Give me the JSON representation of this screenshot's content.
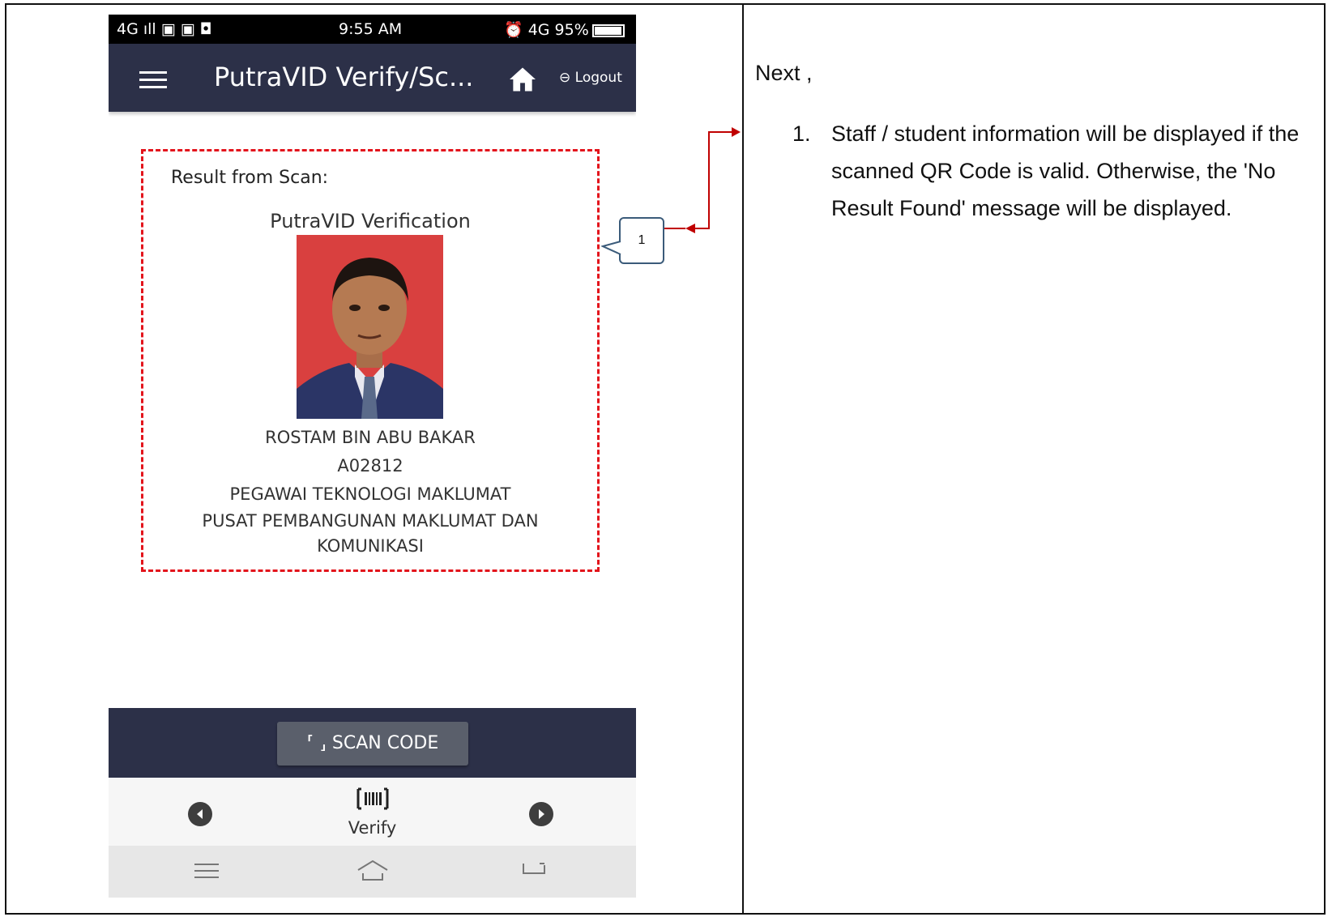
{
  "status_bar": {
    "left": "4G ıll  ▣ ▣ ◘",
    "time": "9:55 AM",
    "right": "⏰ 4G 95%"
  },
  "header": {
    "title": "PutraVID Verify/Sc...",
    "logout_label": "Logout"
  },
  "result": {
    "heading": "Result from Scan:",
    "verification_title": "PutraVID Verification",
    "name": "ROSTAM BIN ABU BAKAR",
    "staff_id": "A02812",
    "position": "PEGAWAI TEKNOLOGI MAKLUMAT",
    "department": "PUSAT PEMBANGUNAN MAKLUMAT DAN KOMUNIKASI"
  },
  "scan_button": {
    "label": "SCAN CODE"
  },
  "bottom_nav": {
    "verify_label": "Verify"
  },
  "callout": {
    "number": "1"
  },
  "instructions": {
    "intro": "Next ,",
    "items": [
      {
        "num": "1.",
        "text": "Staff / student information will be displayed if the scanned QR Code is valid. Otherwise, the 'No Result Found' message will be displayed."
      }
    ]
  },
  "colors": {
    "header_bg": "#2c3048",
    "highlight_border": "#e3141c",
    "arrow": "#c00000",
    "callout_border": "#3b5b7a"
  }
}
